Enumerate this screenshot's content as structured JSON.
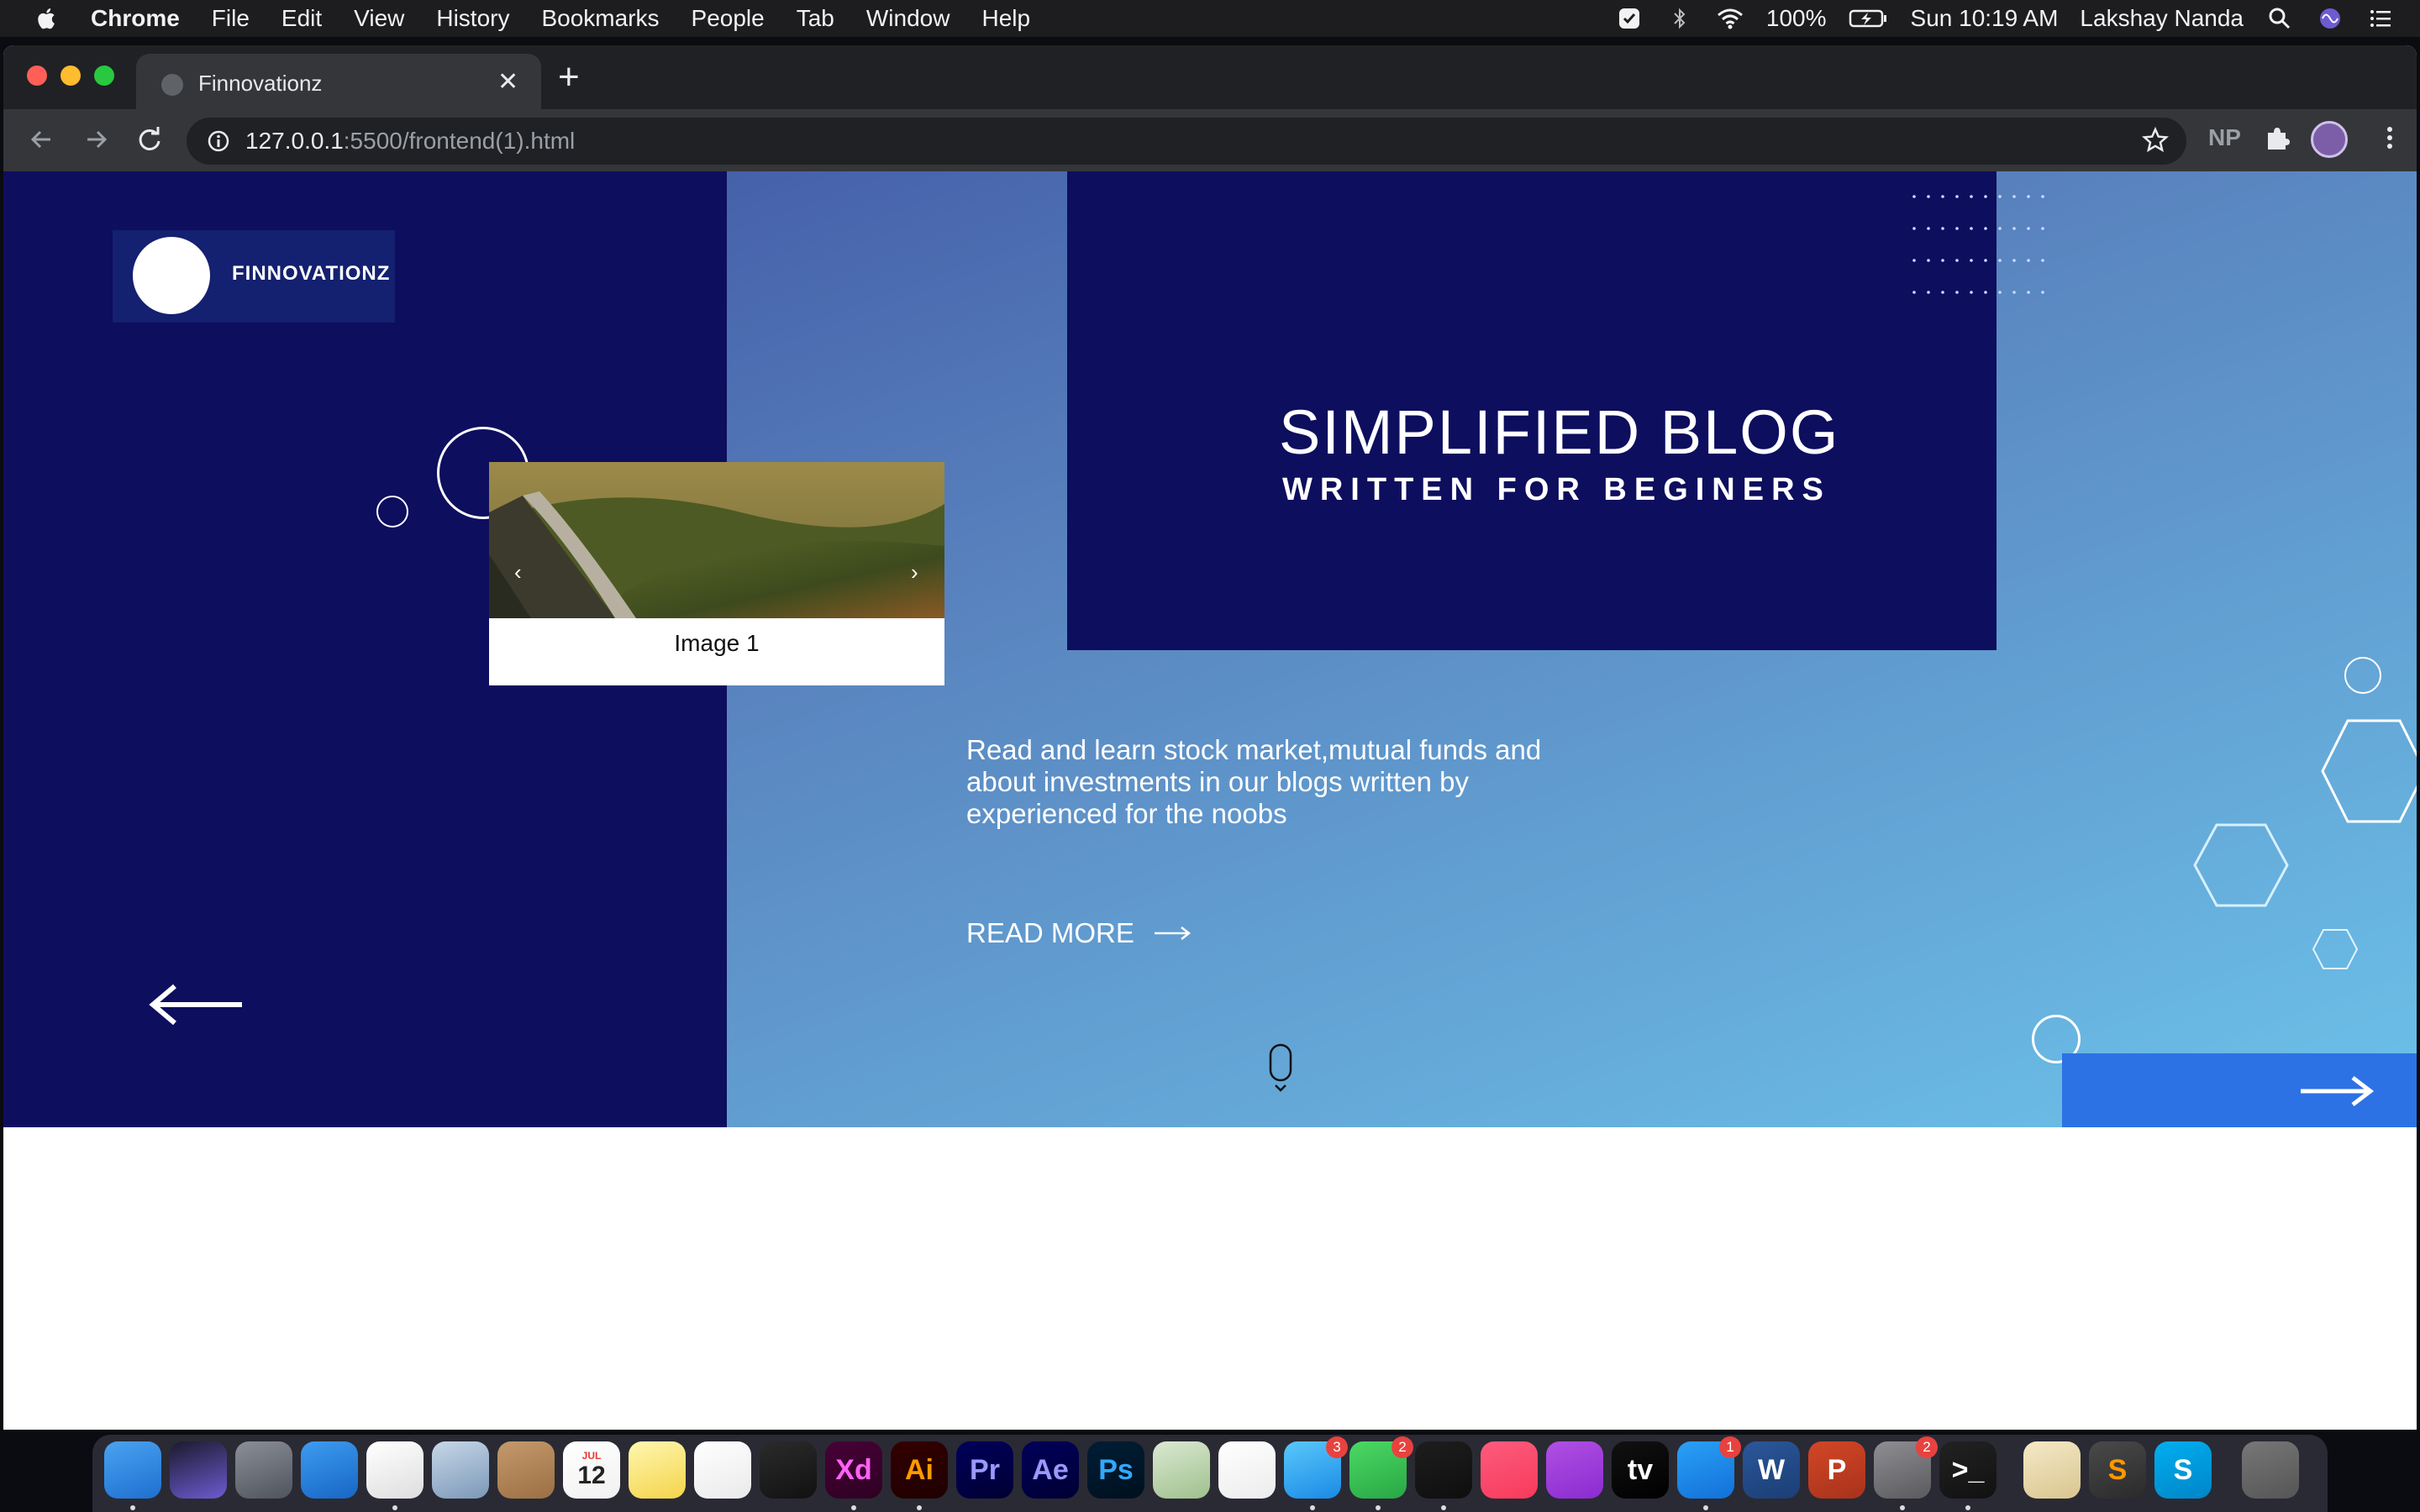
{
  "menubar": {
    "app": "Chrome",
    "items": [
      "File",
      "Edit",
      "View",
      "History",
      "Bookmarks",
      "People",
      "Tab",
      "Window",
      "Help"
    ],
    "battery": "100%",
    "clock": "Sun 10:19 AM",
    "user": "Lakshay Nanda"
  },
  "browser": {
    "tab_title": "Finnovationz",
    "url_host": "127.0.0.1",
    "url_rest": ":5500/frontend(1).html",
    "extension_label": "NP"
  },
  "page": {
    "logo_text": "FINNOVATIONZ",
    "carousel": {
      "caption": "Image 1",
      "prev": "‹",
      "next": "›"
    },
    "headline_1": "SIMPLIFIED BLOG",
    "headline_2": "WRITTEN FOR BEGINERS",
    "description": "Read and learn stock market,mutual funds and about investments in our blogs written by experienced for the noobs",
    "read_more": "READ MORE",
    "colors": {
      "dark_navy": "#0d0e5e",
      "accent_blue": "#2d72e4",
      "gradient_start": "#3c4fa0",
      "gradient_end": "#6cc2ea"
    }
  },
  "dock": {
    "apps": [
      {
        "name": "Finder",
        "label": ""
      },
      {
        "name": "Siri",
        "label": ""
      },
      {
        "name": "Launchpad",
        "label": ""
      },
      {
        "name": "Safari",
        "label": ""
      },
      {
        "name": "Chrome",
        "label": ""
      },
      {
        "name": "Preview",
        "label": ""
      },
      {
        "name": "Contacts",
        "label": ""
      },
      {
        "name": "Calendar",
        "label": "12",
        "sublabel": "JUL"
      },
      {
        "name": "Notes",
        "label": ""
      },
      {
        "name": "Reminders",
        "label": ""
      },
      {
        "name": "Final Cut Pro",
        "label": ""
      },
      {
        "name": "Adobe XD",
        "label": "Xd"
      },
      {
        "name": "Illustrator",
        "label": "Ai"
      },
      {
        "name": "Premiere Pro",
        "label": "Pr"
      },
      {
        "name": "After Effects",
        "label": "Ae"
      },
      {
        "name": "Photoshop",
        "label": "Ps"
      },
      {
        "name": "Maps",
        "label": ""
      },
      {
        "name": "Photos",
        "label": ""
      },
      {
        "name": "Messages",
        "label": "",
        "badge": "3"
      },
      {
        "name": "FaceTime",
        "label": "",
        "badge": "2"
      },
      {
        "name": "VS Code",
        "label": ""
      },
      {
        "name": "Music",
        "label": ""
      },
      {
        "name": "Podcasts",
        "label": ""
      },
      {
        "name": "Apple TV",
        "label": "tv"
      },
      {
        "name": "App Store",
        "label": "",
        "badge": "1"
      },
      {
        "name": "Word",
        "label": "W"
      },
      {
        "name": "PowerPoint",
        "label": "P"
      },
      {
        "name": "System Preferences",
        "label": "",
        "badge": "2"
      },
      {
        "name": "Terminal",
        "label": ">_"
      },
      {
        "name": "Grapher",
        "label": ""
      },
      {
        "name": "Sublime Text",
        "label": "S"
      },
      {
        "name": "Skype",
        "label": "S"
      },
      {
        "name": "Trash",
        "label": ""
      }
    ]
  }
}
